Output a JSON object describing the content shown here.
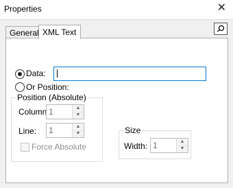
{
  "window": {
    "title": "Properties",
    "close_glyph": "✕"
  },
  "tabs": [
    {
      "label": "General",
      "active": false
    },
    {
      "label": "XML Text",
      "active": true
    }
  ],
  "pin_icon": "pin-icon",
  "form": {
    "data_label": "Data:",
    "data_value": "",
    "or_position_label": "Or Position:",
    "position_group_label": "Position (Absolute)",
    "column_label": "Column:",
    "column_value": "1",
    "line_label": "Line:",
    "line_value": "1",
    "force_absolute_label": "Force Absolute",
    "size_group_label": "Size",
    "width_label": "Width:",
    "width_value": "1",
    "selected_option": "Data"
  },
  "colors": {
    "focus_border": "#0078d7",
    "background": "#f0f0f0",
    "panel": "#ffffff"
  }
}
